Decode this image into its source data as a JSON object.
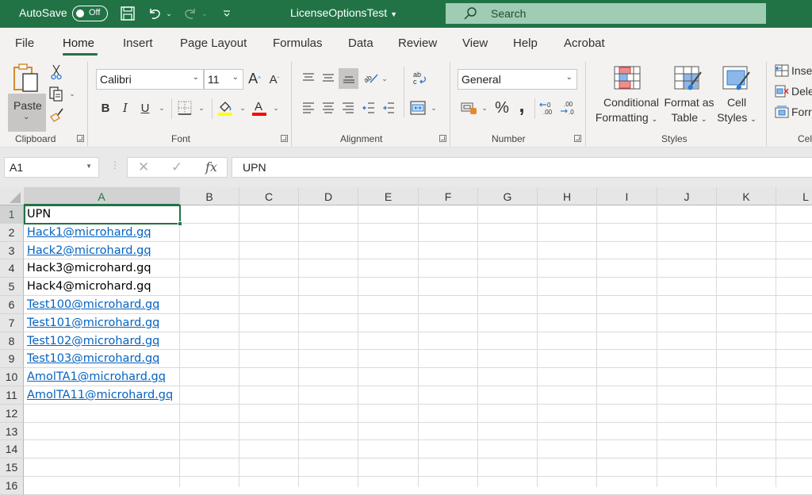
{
  "titlebar": {
    "autosave_label": "AutoSave",
    "autosave_state": "Off",
    "document_title": "LicenseOptionsTest",
    "search_placeholder": "Search",
    "icons": [
      "save-icon",
      "undo-icon",
      "redo-icon",
      "customize-qat-icon"
    ]
  },
  "tabs": [
    {
      "label": "File"
    },
    {
      "label": "Home",
      "active": true
    },
    {
      "label": "Insert"
    },
    {
      "label": "Page Layout"
    },
    {
      "label": "Formulas"
    },
    {
      "label": "Data"
    },
    {
      "label": "Review"
    },
    {
      "label": "View"
    },
    {
      "label": "Help"
    },
    {
      "label": "Acrobat"
    }
  ],
  "ribbon": {
    "clipboard": {
      "label": "Clipboard",
      "paste_label": "Paste"
    },
    "font": {
      "label": "Font",
      "font_name": "Calibri",
      "font_size": "11",
      "bold": "B",
      "italic": "I",
      "underline": "U",
      "highlight_color": "#ffff00",
      "font_color": "#ff0000"
    },
    "alignment": {
      "label": "Alignment"
    },
    "number": {
      "label": "Number",
      "format": "General",
      "percent": "%",
      "comma": ","
    },
    "styles": {
      "label": "Styles",
      "conditional_formatting": [
        "Conditional",
        "Formatting"
      ],
      "format_as_table": [
        "Format as",
        "Table"
      ],
      "cell_styles": [
        "Cell",
        "Styles"
      ]
    },
    "cells": {
      "label": "Cel",
      "insert": "Inse",
      "delete": "Dele",
      "format": "Forr"
    }
  },
  "formula_bar": {
    "name_box": "A1",
    "fx": "fx",
    "content": "UPN"
  },
  "sheet": {
    "columns": [
      "A",
      "B",
      "C",
      "D",
      "E",
      "F",
      "G",
      "H",
      "I",
      "J",
      "K",
      "L"
    ],
    "selected_column": "A",
    "rows": [
      "1",
      "2",
      "3",
      "4",
      "5",
      "6",
      "7",
      "8",
      "9",
      "10",
      "11",
      "12",
      "13",
      "14",
      "15",
      "16"
    ],
    "selected_row": "1",
    "active_cell": "A1",
    "cells_A": [
      {
        "value": "UPN",
        "link": false
      },
      {
        "value": "Hack1@microhard.gq",
        "link": true
      },
      {
        "value": "Hack2@microhard.gq",
        "link": true
      },
      {
        "value": "Hack3@microhard.gq",
        "link": false
      },
      {
        "value": "Hack4@microhard.gq",
        "link": false
      },
      {
        "value": "Test100@microhard.gq",
        "link": true
      },
      {
        "value": "Test101@microhard.gq",
        "link": true
      },
      {
        "value": "Test102@microhard.gq",
        "link": true
      },
      {
        "value": "Test103@microhard.gq",
        "link": true
      },
      {
        "value": "AmolTA1@microhard.gq",
        "link": true
      },
      {
        "value": "AmolTA11@microhard.gq",
        "link": true
      }
    ]
  },
  "colors": {
    "brand": "#217346",
    "link": "#0563c1"
  }
}
